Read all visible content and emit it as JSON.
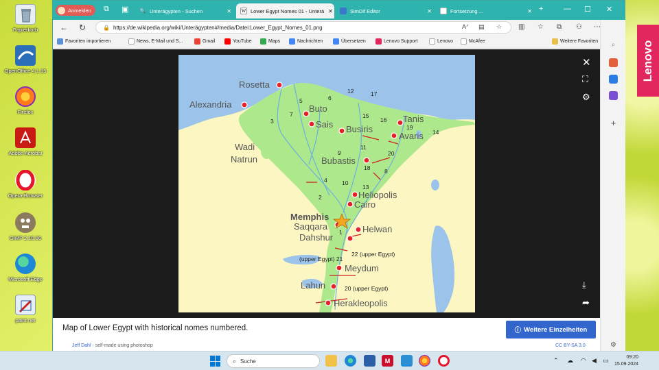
{
  "desktop": {
    "icons": [
      {
        "label": "Papierkorb",
        "name": "recycle-bin",
        "color": "#dfe8ee"
      },
      {
        "label": "OpenOffice 4.1.15",
        "name": "openoffice",
        "color": "#2a6fb8"
      },
      {
        "label": "Firefox",
        "name": "firefox",
        "color": "#ff7a1a"
      },
      {
        "label": "Adobe Acrobat",
        "name": "adobe-acrobat",
        "color": "#c91a14"
      },
      {
        "label": "Opera-Browser",
        "name": "opera",
        "color": "#e5162b"
      },
      {
        "label": "GIMP 2.10.36",
        "name": "gimp",
        "color": "#7a6a52"
      },
      {
        "label": "Microsoft Edge",
        "name": "edge",
        "color": "#1f88d4"
      },
      {
        "label": "paint.net",
        "name": "paint-net",
        "color": "#e6eef6"
      }
    ]
  },
  "lenovo_badge": "Lenovo",
  "browser": {
    "profile_label": "Anmelden",
    "tabs": [
      {
        "label": "Unterägypten - Suchen",
        "active": false
      },
      {
        "label": "Lower Egypt Nomes 01 - Unterä",
        "active": true
      },
      {
        "label": "SimDif Editor",
        "active": false
      },
      {
        "label": "Fortsetzung ...",
        "active": false
      }
    ],
    "url": "https://de.wikipedia.org/wiki/Unterägypten#/media/Datei:Lower_Egypt_Nomes_01.png",
    "favorites": [
      "Favoriten importieren",
      "News, E-Mail und S...",
      "Gmail",
      "YouTube",
      "Maps",
      "Nachrichten",
      "Übersetzen",
      "Lenovo Support",
      "Lenovo",
      "McAfee"
    ],
    "favorites_folder": "Weitere Favoriten"
  },
  "viewer": {
    "caption": "Map of Lower Egypt with historical nomes numbered.",
    "details_button": "Weitere Einzelheiten",
    "author_name": "Jeff Dahl",
    "author_note": "- self-made using photoshop",
    "license": "CC BY-SA 3.0"
  },
  "map": {
    "cities": [
      {
        "name": "Rosetta"
      },
      {
        "name": "Alexandria"
      },
      {
        "name": "Buto"
      },
      {
        "name": "Sais"
      },
      {
        "name": "Busiris"
      },
      {
        "name": "Tanis"
      },
      {
        "name": "Avaris"
      },
      {
        "name": "Wadi"
      },
      {
        "name": "Natrun"
      },
      {
        "name": "Bubastis"
      },
      {
        "name": "Heliopolis"
      },
      {
        "name": "Cairo"
      },
      {
        "name": "Memphis"
      },
      {
        "name": "Saqqara"
      },
      {
        "name": "Helwan"
      },
      {
        "name": "Dahshur"
      },
      {
        "name": "Meydum"
      },
      {
        "name": "Lahun"
      },
      {
        "name": "Herakleopolis"
      }
    ],
    "nome_numbers": [
      "12",
      "17",
      "6",
      "5",
      "7",
      "3",
      "15",
      "16",
      "19",
      "14",
      "11",
      "9",
      "20",
      "18",
      "8",
      "4",
      "10",
      "13",
      "2",
      "1"
    ],
    "annotations": [
      "22 (upper Egypt)",
      "(upper Egypt) 21",
      "20 (upper Egypt)"
    ]
  },
  "taskbar": {
    "search_placeholder": "Suche",
    "time": "09:20",
    "date": "15.09.2024"
  }
}
